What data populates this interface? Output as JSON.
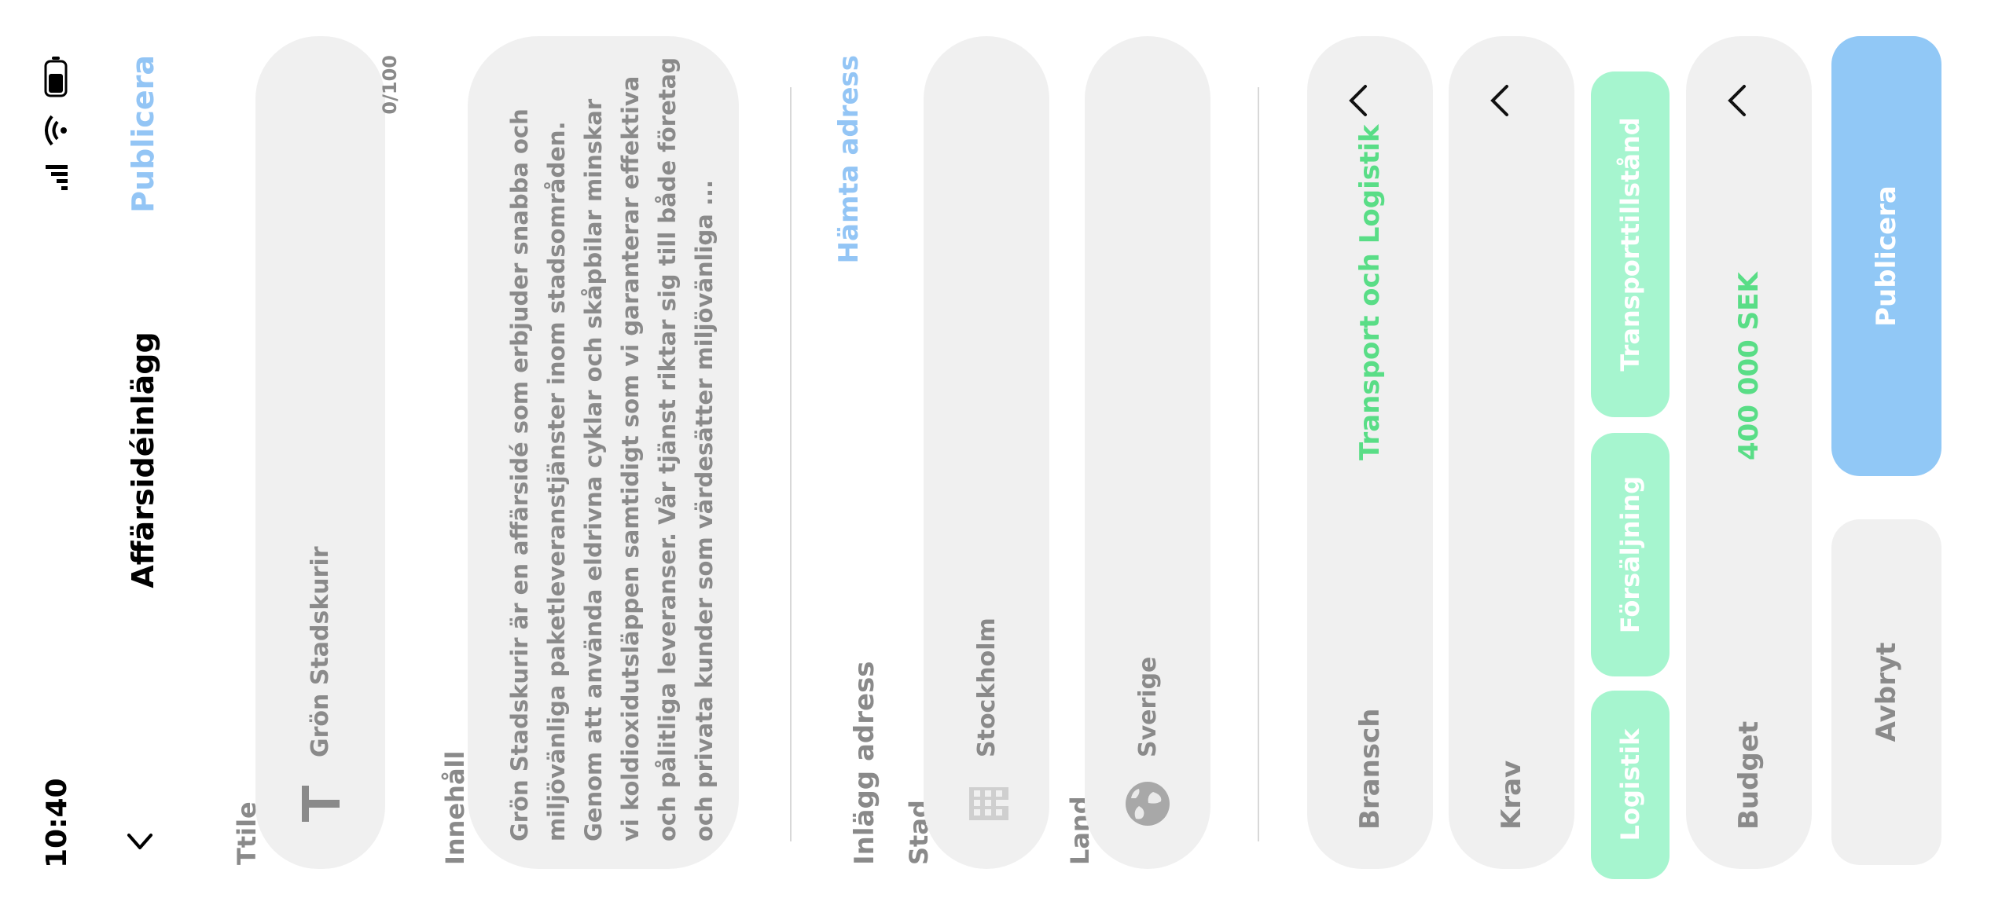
{
  "status_bar": {
    "time": "10:40"
  },
  "header": {
    "title": "Affärsidéinlägg",
    "publish_link": "Publicera"
  },
  "title_field": {
    "label": "Ttile",
    "value": "Grön Stadskurir",
    "counter": "0/100"
  },
  "content_field": {
    "label": "Innehåll",
    "lines": [
      "Grön Stadskurir är en affärsidé som erbjuder snabba och",
      "miljövänliga paketleveranstjänster inom stadsområden.",
      "Genom att använda eldrivna cyklar och skåpbilar minskar",
      "vi koldioxidutsläppen samtidigt som vi garanterar effektiva",
      "och pålitliga leveranser. Vår tjänst riktar sig till både företag",
      "och privata kunder som värdesätter miljövänliga ..."
    ]
  },
  "address": {
    "label": "Inlägg adress",
    "fetch_link": "Hämta adress",
    "city_label": "Stad",
    "city_value": "Stockholm",
    "country_label": "Land",
    "country_value": "Sverige"
  },
  "industry": {
    "label": "Bransch",
    "value": "Transport och Logistik"
  },
  "requirements": {
    "label": "Krav",
    "chips": [
      "Logistik",
      "Försäljning",
      "Transporttillstånd"
    ]
  },
  "budget": {
    "label": "Budget",
    "value": "400 000 SEK"
  },
  "footer": {
    "cancel": "Avbryt",
    "publish": "Publicera"
  },
  "icons": {
    "back": "chevron-left-icon",
    "title": "text-icon",
    "city": "building-icon",
    "country": "globe-icon",
    "signal": "signal-icon",
    "wifi": "wifi-icon",
    "battery": "battery-icon"
  },
  "colors": {
    "accent_blue": "#93c5f5",
    "green": "#59dd86",
    "chip_green": "#a6f5cf",
    "field_bg": "#f0f0f0",
    "muted_text": "#8a8a8a"
  }
}
